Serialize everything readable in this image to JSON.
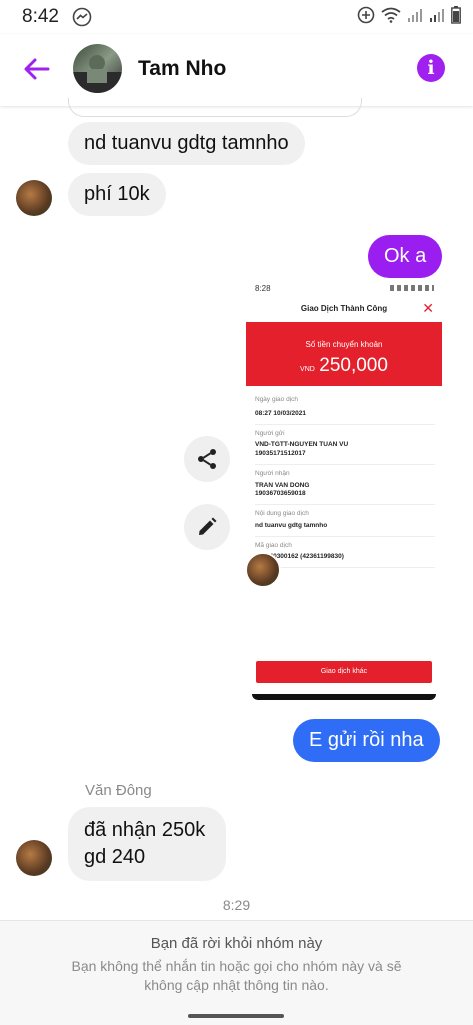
{
  "status_bar": {
    "time": "8:42"
  },
  "header": {
    "contact_name": "Tam Nho"
  },
  "messages": {
    "m1": "nd tuanvu gdtg tamnho",
    "m2": "phí 10k",
    "m3": "Ok a",
    "m4": "E gửi rồi nha",
    "sender_name": "Văn Đông",
    "m5_line1": "đã nhận 250k",
    "m5_line2": "gd 240",
    "timestamp": "8:29"
  },
  "receipt": {
    "time": "8:28",
    "title": "Giao Dịch Thành Công",
    "amount_label": "Số tiền chuyển khoản",
    "currency": "VND",
    "amount": "250,000",
    "date_label": "Ngày giao dịch",
    "date": "08:27 10/03/2021",
    "sender_label": "Người gửi",
    "sender_name": "VND-TGTT-NGUYEN TUAN VU",
    "sender_account": "19035171512017",
    "recipient_label": "Người nhận",
    "recipient_name": "TRAN VAN DONG",
    "recipient_account": "19036703659018",
    "content_label": "Nội dung giao dịch",
    "content": "nd tuanvu gdtg tamnho",
    "txn_label": "Mã giao dịch",
    "txn_code": "069040300162 (42361199830)",
    "button": "Giao dịch khác"
  },
  "footer": {
    "title": "Bạn đã rời khỏi nhóm này",
    "desc_line1": "Bạn không thể nhắn tin hoặc gọi cho nhóm này và sẽ",
    "desc_line2": "không cập nhật thông tin nào."
  },
  "colors": {
    "accent": "#a020f0",
    "outgoing_purple": "#9a1ef0",
    "outgoing_blue": "#2f6df6",
    "bank_red": "#e3202c"
  },
  "icons": [
    "messenger-icon",
    "add-circle-icon",
    "wifi-icon",
    "signal-icon",
    "battery-icon",
    "back-arrow-icon",
    "info-icon",
    "share-icon",
    "pencil-icon"
  ]
}
